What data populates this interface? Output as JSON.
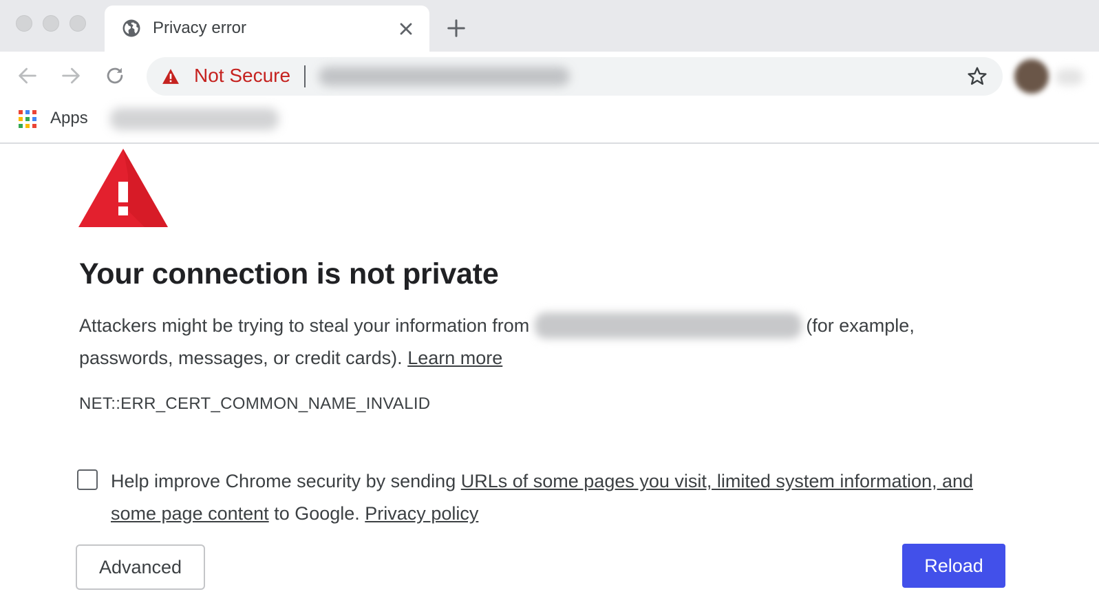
{
  "window": {
    "traffic_lights": [
      "close",
      "minimize",
      "zoom"
    ]
  },
  "tab": {
    "title": "Privacy error",
    "icon": "globe-icon",
    "close_icon": "close-icon"
  },
  "new_tab_icon": "plus-icon",
  "toolbar": {
    "back_icon": "arrow-left-icon",
    "forward_icon": "arrow-right-icon",
    "reload_icon": "reload-icon",
    "security_status": "Not Secure",
    "security_icon": "warning-triangle-icon",
    "bookmark_icon": "star-icon"
  },
  "bookmarks": {
    "apps_label": "Apps",
    "apps_icon": "apps-grid-icon"
  },
  "interstitial": {
    "headline": "Your connection is not private",
    "explain_before": "Attackers might be trying to steal your information from",
    "explain_after": "(for example, passwords, messages, or credit cards).",
    "learn_more": "Learn more",
    "error_code": "NET::ERR_CERT_COMMON_NAME_INVALID",
    "optin_prefix": "Help improve Chrome security by sending",
    "optin_link": "URLs of some pages you visit, limited system information, and some page content",
    "optin_mid": "to Google.",
    "privacy_policy": "Privacy policy",
    "advanced_button": "Advanced",
    "reload_button": "Reload"
  },
  "colors": {
    "warning_red": "#e3202e",
    "not_secure_red": "#c5221f",
    "reload_blue": "#4250ea",
    "tabstrip_gray": "#e8e9ec"
  }
}
